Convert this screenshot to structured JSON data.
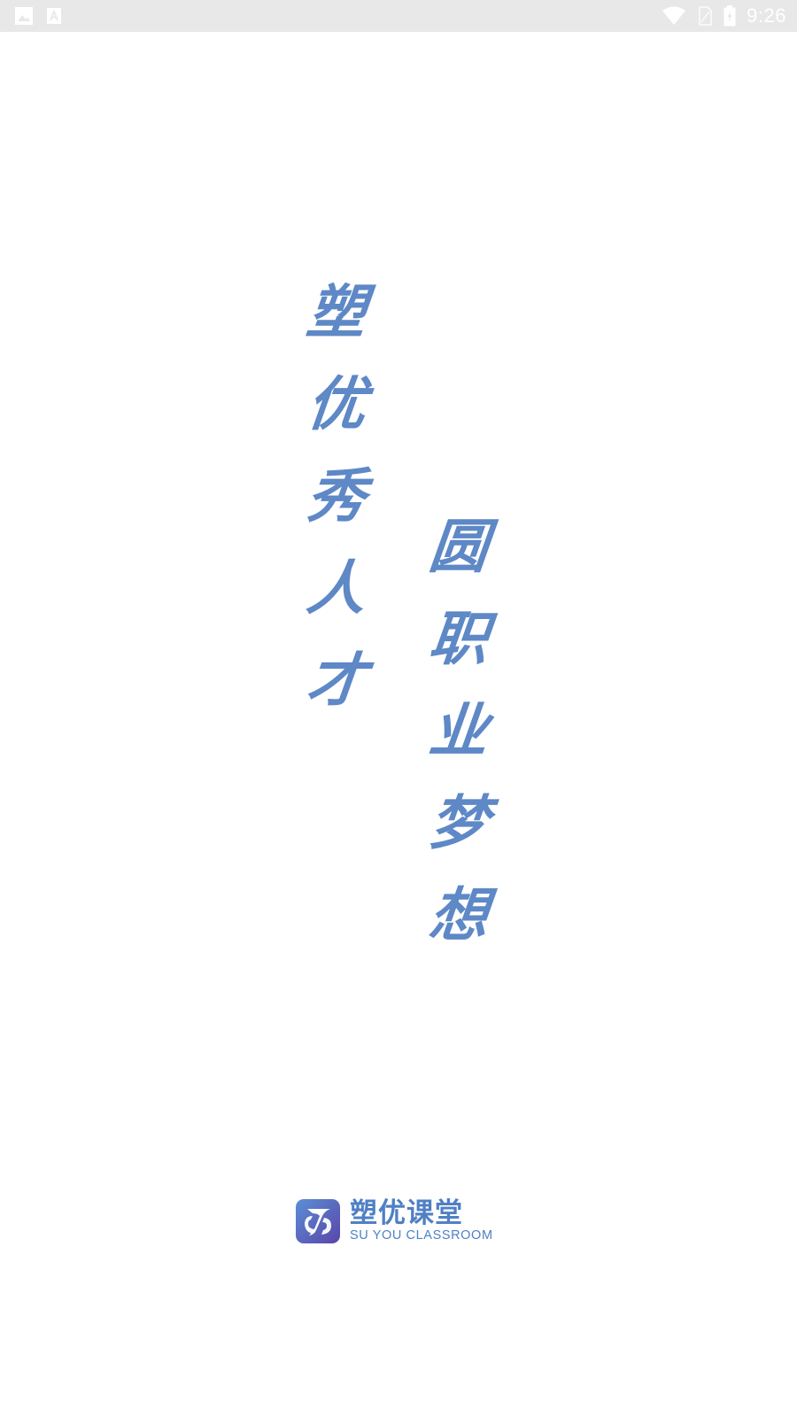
{
  "status_bar": {
    "time": "9:26",
    "left_icons": [
      "image-icon",
      "font-a-icon"
    ],
    "right_icons": [
      "wifi-icon",
      "sim-no-signal-icon",
      "battery-charging-icon"
    ]
  },
  "slogan": {
    "left_column": [
      "塑",
      "优",
      "秀",
      "人",
      "才"
    ],
    "right_column": [
      "圆",
      "职",
      "业",
      "梦",
      "想"
    ]
  },
  "brand": {
    "name_cn": "塑优课堂",
    "name_en": "SU YOU CLASSROOM",
    "mark_icon": "suyou-logo-icon"
  },
  "colors": {
    "status_bar_bg": "#e8e8e8",
    "calligraphy": "#5e88c6",
    "brand_text": "#4f80c5",
    "logo_gradient_start": "#5b8fd6",
    "logo_gradient_end": "#5a45a8"
  }
}
